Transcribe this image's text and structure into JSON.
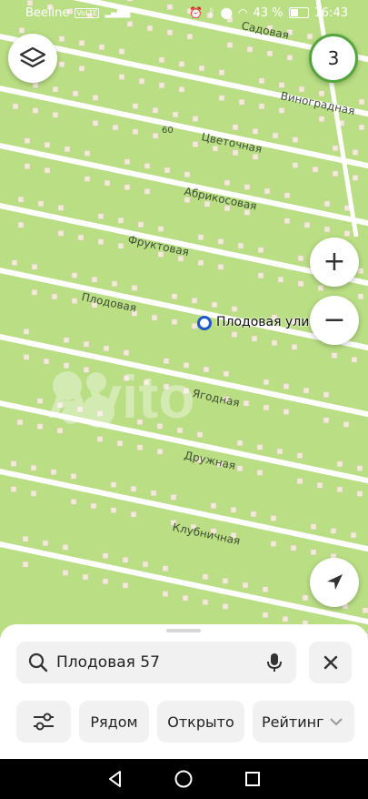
{
  "status_bar": {
    "carrier": "Beeline",
    "battery": "43 %",
    "time": "16:43"
  },
  "map": {
    "street_labels": [
      "Садовая",
      "Виноградная",
      "Цветочная",
      "Абрикосовая",
      "Фруктовая",
      "Плодовая",
      "Ягодная",
      "Дружная",
      "Клубничная"
    ],
    "house_number": "60",
    "pin_label": "Плодовая ули",
    "watermark": "Avito",
    "badge_count": "3"
  },
  "sheet": {
    "search_value": "Плодовая 57",
    "chips": [
      "Рядом",
      "Открыто",
      "Рейтинг"
    ]
  }
}
